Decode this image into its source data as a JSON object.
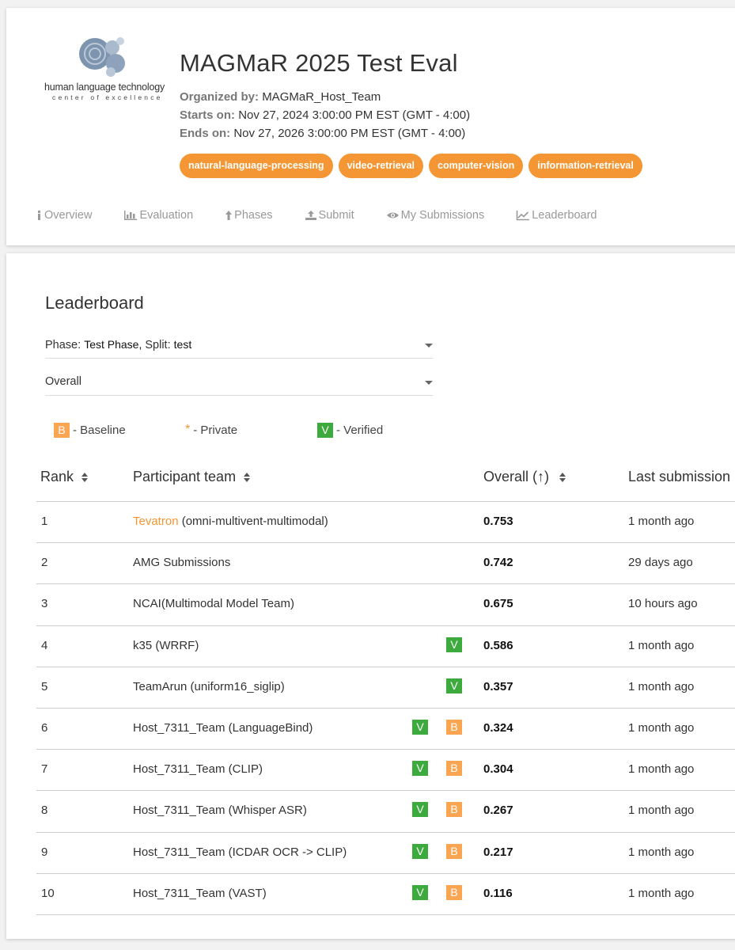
{
  "logo": {
    "line1": "human language technology",
    "line2": "center of excellence"
  },
  "challenge": {
    "title": "MAGMaR 2025 Test Eval",
    "organized_label": "Organized by:",
    "organizer": "MAGMaR_Host_Team",
    "starts_label": "Starts on:",
    "starts": "Nov 27, 2024 3:00:00 PM EST (GMT - 4:00)",
    "ends_label": "Ends on:",
    "ends": "Nov 27, 2026 3:00:00 PM EST (GMT - 4:00)",
    "tags": [
      "natural-language-processing",
      "video-retrieval",
      "computer-vision",
      "information-retrieval"
    ]
  },
  "nav": [
    {
      "label": "Overview",
      "icon": "info-icon"
    },
    {
      "label": "Evaluation",
      "icon": "bar-chart-icon"
    },
    {
      "label": "Phases",
      "icon": "arrow-up-icon"
    },
    {
      "label": "Submit",
      "icon": "upload-icon"
    },
    {
      "label": "My Submissions",
      "icon": "eye-icon"
    },
    {
      "label": "Leaderboard",
      "icon": "line-chart-icon"
    }
  ],
  "leaderboard": {
    "title": "Leaderboard",
    "phase_label": "Phase:",
    "phase_value": "Test Phase,",
    "split_label": "Split:",
    "split_value": "test",
    "metric_select": "Overall",
    "legend": {
      "baseline_badge": "B",
      "baseline_label": "- Baseline",
      "private_mark": "*",
      "private_label": "- Private",
      "verified_badge": "V",
      "verified_label": "- Verified"
    },
    "columns": {
      "rank": "Rank",
      "team": "Participant team",
      "score": "Overall (↑)",
      "last": "Last submission"
    },
    "rows": [
      {
        "rank": "1",
        "team": "Tevatron",
        "method": " (omni-multivent-multimodal)",
        "score": "0.753",
        "last": "1 month ago",
        "verified": false,
        "baseline": false,
        "link": true
      },
      {
        "rank": "2",
        "team": "AMG Submissions",
        "method": "",
        "score": "0.742",
        "last": "29 days ago",
        "verified": false,
        "baseline": false,
        "link": false
      },
      {
        "rank": "3",
        "team": "NCAI(Multimodal Model Team)",
        "method": "",
        "score": "0.675",
        "last": "10 hours ago",
        "verified": false,
        "baseline": false,
        "link": false
      },
      {
        "rank": "4",
        "team": "k35 (WRRF)",
        "method": "",
        "score": "0.586",
        "last": "1 month ago",
        "verified": true,
        "baseline": false,
        "link": false
      },
      {
        "rank": "5",
        "team": "TeamArun (uniform16_siglip)",
        "method": "",
        "score": "0.357",
        "last": "1 month ago",
        "verified": true,
        "baseline": false,
        "link": false
      },
      {
        "rank": "6",
        "team": "Host_7311_Team (LanguageBind)",
        "method": "",
        "score": "0.324",
        "last": "1 month ago",
        "verified": true,
        "baseline": true,
        "link": false
      },
      {
        "rank": "7",
        "team": "Host_7311_Team (CLIP)",
        "method": "",
        "score": "0.304",
        "last": "1 month ago",
        "verified": true,
        "baseline": true,
        "link": false
      },
      {
        "rank": "8",
        "team": "Host_7311_Team (Whisper ASR)",
        "method": "",
        "score": "0.267",
        "last": "1 month ago",
        "verified": true,
        "baseline": true,
        "link": false
      },
      {
        "rank": "9",
        "team": "Host_7311_Team (ICDAR OCR -> CLIP)",
        "method": "",
        "score": "0.217",
        "last": "1 month ago",
        "verified": true,
        "baseline": true,
        "link": false
      },
      {
        "rank": "10",
        "team": "Host_7311_Team (VAST)",
        "method": "",
        "score": "0.116",
        "last": "1 month ago",
        "verified": true,
        "baseline": true,
        "link": false
      }
    ]
  },
  "colors": {
    "accent": "#f39633",
    "verified": "#3daa3d",
    "baseline": "#f9a551"
  }
}
